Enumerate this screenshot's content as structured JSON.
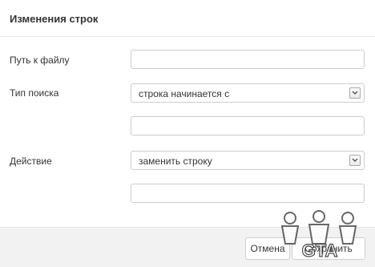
{
  "dialog": {
    "title": "Изменения строк"
  },
  "form": {
    "file_path": {
      "label": "Путь к файлу",
      "value": "",
      "placeholder": ""
    },
    "search_type": {
      "label": "Тип поиска",
      "selected": "строка начинается с"
    },
    "search_value": {
      "value": "",
      "placeholder": ""
    },
    "action": {
      "label": "Действие",
      "selected": "заменить строку"
    },
    "replace_value": {
      "value": "",
      "placeholder": ""
    }
  },
  "footer": {
    "cancel_label": "Отмена",
    "save_label": "Сохранить"
  },
  "watermark": {
    "text": "GTA"
  },
  "colors": {
    "border": "#cccccc",
    "footer_bg": "#f2f2f2",
    "text": "#333333"
  }
}
